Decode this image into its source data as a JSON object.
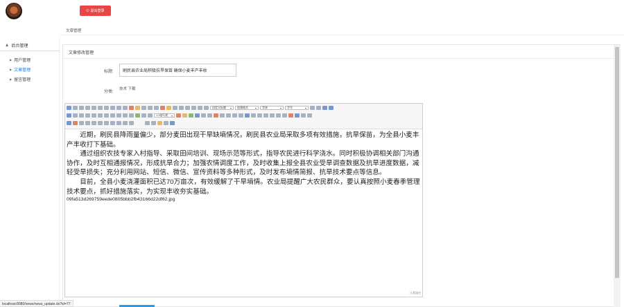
{
  "header": {
    "exit_label": "退出登录"
  },
  "sidebar": {
    "title": "后台管理",
    "items": [
      {
        "label": "用户管理",
        "active": false
      },
      {
        "label": "文章管理",
        "active": true
      },
      {
        "label": "留言管理",
        "active": false
      }
    ]
  },
  "breadcrumb": "文章管理",
  "panel": {
    "title": "文章修改管理"
  },
  "form": {
    "title_label": "标题:",
    "title_value": "刷民县农业局积极抗旱保苗 确保小麦丰产丰收",
    "category_label": "分类:",
    "category_value": "技术 下载"
  },
  "editor": {
    "toolbar_selects": [
      "自定义标题",
      "段落格式",
      "字体",
      "字号",
      "1.5倍行距"
    ],
    "paragraphs": [
      "近期，刷民县降雨量偏少，部分麦田出现干旱缺墒情况，刷民县农业局采取多项有效措施，抗旱保苗，为全县小麦丰产丰收打下基础。",
      "通过组织农技专家入村指导、采取田间培训、现场示范等形式，指导农民进行科学浇水。同时积极协调相关部门沟通协作，及时互相通报情况，形成抗旱合力；加强农情调度工作，及时收集上报全县农业受旱调查数据及抗旱进度数据，减轻受旱损失；充分利用网站、短信、微信、宣传资料等多种形式，及时发布墒情简报、抗旱技术要点等信息。",
      "目前，全县小麦浇灌面积已达70万亩次，有效缓解了干旱墒情。农业局提醒广大农民群众，要认真按照小麦春季管理技术要点，抓好措施落实，为实现丰收夯实基础。"
    ],
    "filename": "09fa513d269759eede0805bbb2fb43166d22df62.jpg",
    "resize_hint": "元素路径"
  },
  "status_url": "localhost:8080/news/news_update.do?id=77",
  "colors": {
    "exit_button": "#e84545",
    "active_link": "#2a7ae2",
    "accent": "#2a9ae2"
  }
}
